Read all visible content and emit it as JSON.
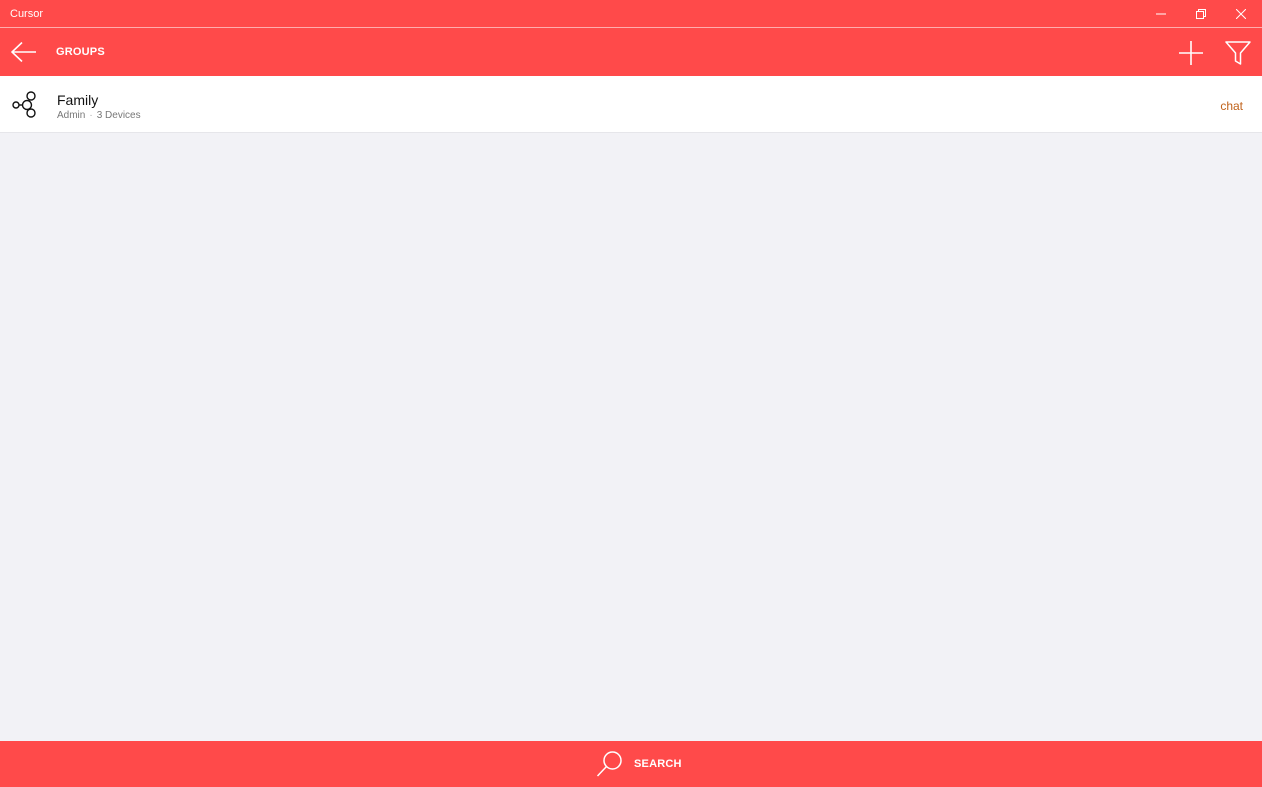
{
  "window": {
    "title": "Cursor",
    "controls": {
      "minimize": "minimize-icon",
      "maximize": "restore-icon",
      "close": "close-icon"
    }
  },
  "header": {
    "title": "GROUPS",
    "back_icon": "arrow-left-icon",
    "add_icon": "plus-icon",
    "filter_icon": "filter-icon"
  },
  "groups": [
    {
      "name": "Family",
      "role": "Admin",
      "devices": "3 Devices",
      "action": "chat",
      "icon": "share-nodes-icon"
    }
  ],
  "bottom_bar": {
    "search_label": "SEARCH",
    "search_icon": "search-icon"
  },
  "colors": {
    "accent": "#ff4a4a",
    "background": "#f2f2f6",
    "link": "#c0621a"
  }
}
